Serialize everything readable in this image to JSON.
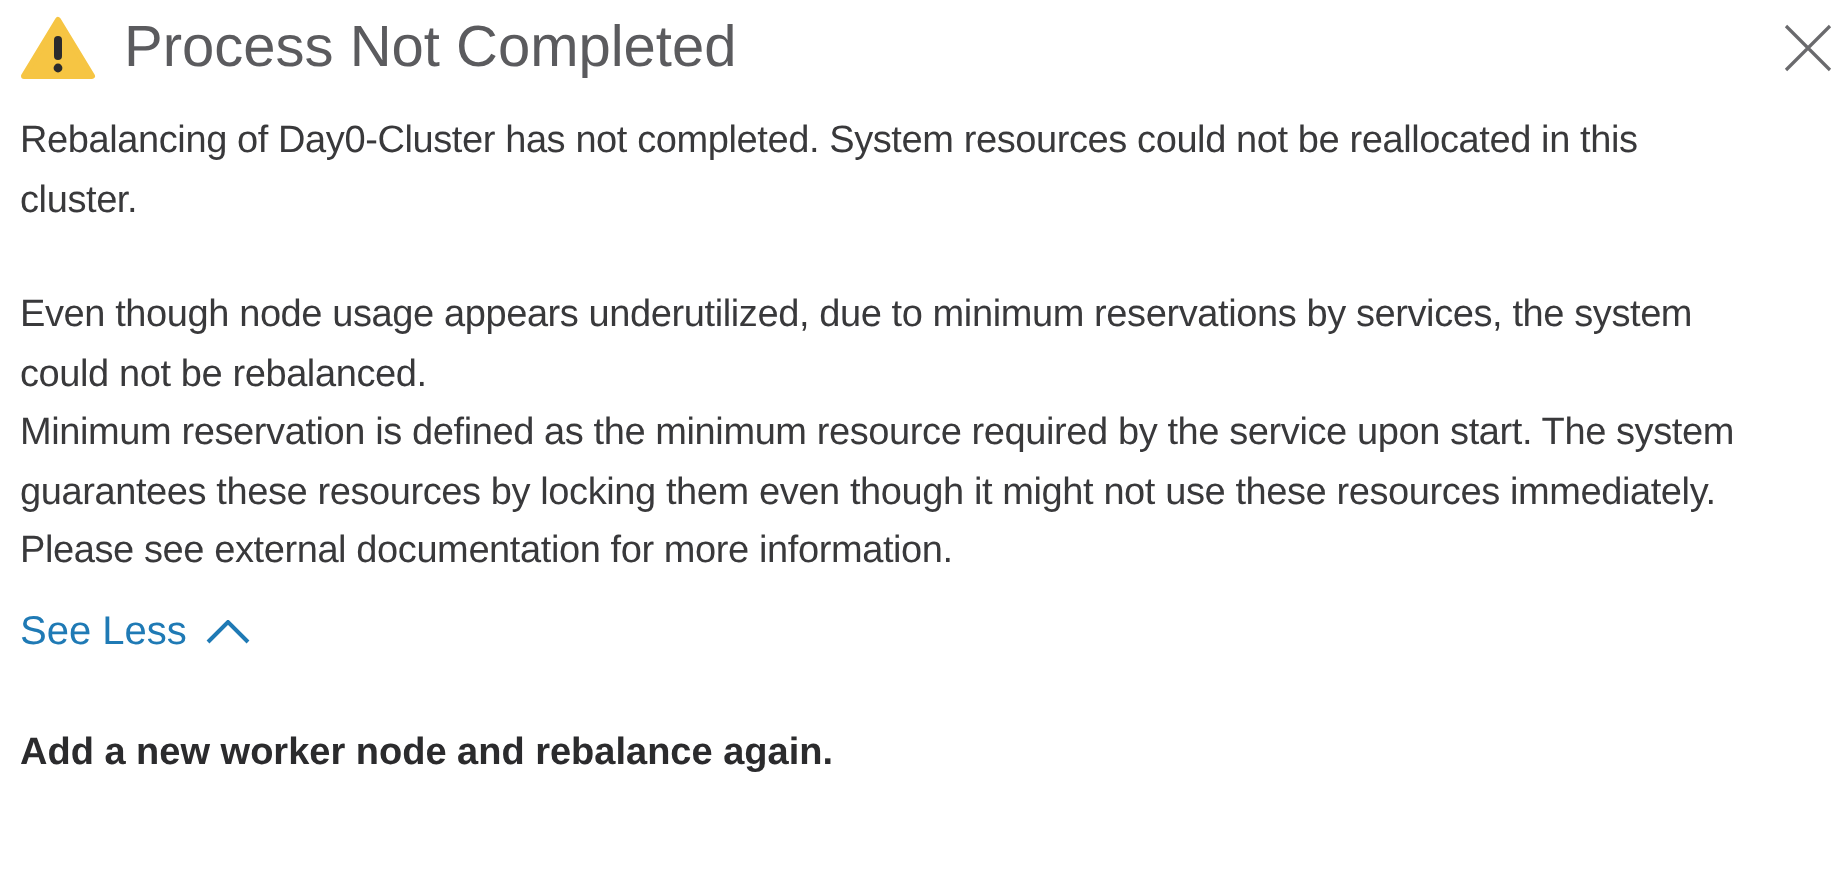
{
  "dialog": {
    "title": "Process Not Completed",
    "summary": "Rebalancing of Day0-Cluster has not completed. System resources could not be reallocated in this cluster.",
    "details": [
      "Even though node usage appears underutilized, due to minimum reservations by services, the system could not be rebalanced.",
      "Minimum reservation is defined as the minimum resource required by the service upon start. The system guarantees these resources by locking them even though it might not use these resources immediately.",
      "Please see external documentation for more information."
    ],
    "toggle": {
      "label": "See Less",
      "expanded": true
    },
    "action": "Add a new worker node and rebalance again."
  }
}
